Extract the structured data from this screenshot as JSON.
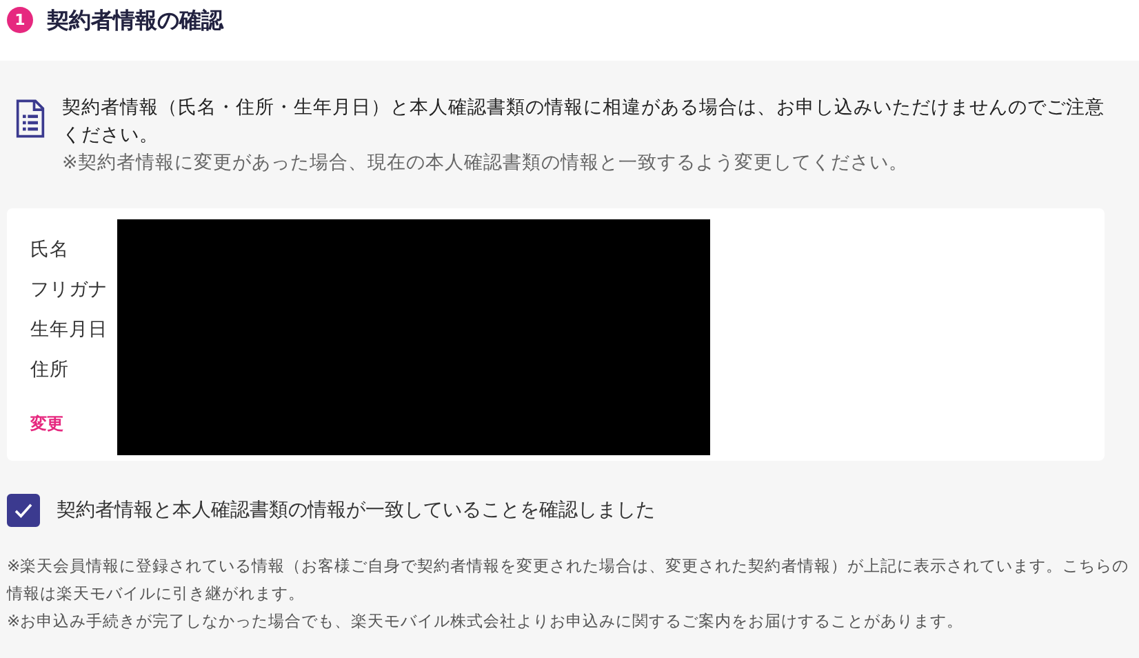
{
  "section": {
    "number": "1",
    "title": "契約者情報の確認"
  },
  "notice": {
    "text": "契約者情報（氏名・住所・生年月日）と本人確認書類の情報に相違がある場合は、お申し込みいただけませんのでご注意ください。",
    "note": "※契約者情報に変更があった場合、現在の本人確認書類の情報と一致するよう変更してください。"
  },
  "fields": [
    {
      "label": "氏名"
    },
    {
      "label": "フリガナ"
    },
    {
      "label": "生年月日"
    },
    {
      "label": "住所"
    }
  ],
  "change_link": "変更",
  "confirm": {
    "label": "契約者情報と本人確認書類の情報が一致していることを確認しました",
    "checked": true
  },
  "footnotes": [
    "※楽天会員情報に登録されている情報（お客様ご自身で契約者情報を変更された場合は、変更された契約者情報）が上記に表示されています。こちらの情報は楽天モバイルに引き継がれます。",
    "※お申込み手続きが完了しなかった場合でも、楽天モバイル株式会社よりお申込みに関するご案内をお届けすることがあります。"
  ]
}
